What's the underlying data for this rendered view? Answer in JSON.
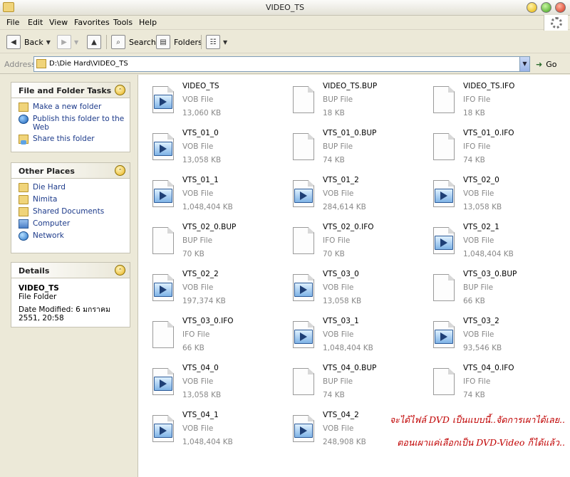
{
  "window": {
    "title": "VIDEO_TS"
  },
  "menu": [
    "File",
    "Edit",
    "View",
    "Favorites",
    "Tools",
    "Help"
  ],
  "toolbar": {
    "back_label": "Back",
    "search_label": "Search",
    "folders_label": "Folders"
  },
  "address": {
    "label": "Address",
    "path": "D:\\Die Hard\\VIDEO_TS",
    "go_label": "Go"
  },
  "tasks": {
    "title": "File and Folder Tasks",
    "items": [
      "Make a new folder",
      "Publish this folder to the Web",
      "Share this folder"
    ]
  },
  "places": {
    "title": "Other Places",
    "items": [
      "Die Hard",
      "Nimita",
      "Shared Documents",
      "Computer",
      "Network"
    ]
  },
  "details": {
    "title": "Details",
    "name": "VIDEO_TS",
    "kind": "File Folder",
    "modified": "Date Modified: 6 มกราคม 2551, 20:58"
  },
  "files": [
    {
      "name": "VIDEO_TS",
      "type": "VOB File",
      "size": "13,060 KB",
      "icon": "media"
    },
    {
      "name": "VIDEO_TS.BUP",
      "type": "BUP File",
      "size": "18 KB",
      "icon": "doc"
    },
    {
      "name": "VIDEO_TS.IFO",
      "type": "IFO File",
      "size": "18 KB",
      "icon": "doc"
    },
    {
      "name": "VTS_01_0",
      "type": "VOB File",
      "size": "13,058 KB",
      "icon": "media"
    },
    {
      "name": "VTS_01_0.BUP",
      "type": "BUP File",
      "size": "74 KB",
      "icon": "doc"
    },
    {
      "name": "VTS_01_0.IFO",
      "type": "IFO File",
      "size": "74 KB",
      "icon": "doc"
    },
    {
      "name": "VTS_01_1",
      "type": "VOB File",
      "size": "1,048,404 KB",
      "icon": "media"
    },
    {
      "name": "VTS_01_2",
      "type": "VOB File",
      "size": "284,614 KB",
      "icon": "media"
    },
    {
      "name": "VTS_02_0",
      "type": "VOB File",
      "size": "13,058 KB",
      "icon": "media"
    },
    {
      "name": "VTS_02_0.BUP",
      "type": "BUP File",
      "size": "70 KB",
      "icon": "doc"
    },
    {
      "name": "VTS_02_0.IFO",
      "type": "IFO File",
      "size": "70 KB",
      "icon": "doc"
    },
    {
      "name": "VTS_02_1",
      "type": "VOB File",
      "size": "1,048,404 KB",
      "icon": "media"
    },
    {
      "name": "VTS_02_2",
      "type": "VOB File",
      "size": "197,374 KB",
      "icon": "media"
    },
    {
      "name": "VTS_03_0",
      "type": "VOB File",
      "size": "13,058 KB",
      "icon": "media"
    },
    {
      "name": "VTS_03_0.BUP",
      "type": "BUP File",
      "size": "66 KB",
      "icon": "doc"
    },
    {
      "name": "VTS_03_0.IFO",
      "type": "IFO File",
      "size": "66 KB",
      "icon": "doc"
    },
    {
      "name": "VTS_03_1",
      "type": "VOB File",
      "size": "1,048,404 KB",
      "icon": "media"
    },
    {
      "name": "VTS_03_2",
      "type": "VOB File",
      "size": "93,546 KB",
      "icon": "media"
    },
    {
      "name": "VTS_04_0",
      "type": "VOB File",
      "size": "13,058 KB",
      "icon": "media"
    },
    {
      "name": "VTS_04_0.BUP",
      "type": "BUP File",
      "size": "74 KB",
      "icon": "doc"
    },
    {
      "name": "VTS_04_0.IFO",
      "type": "IFO File",
      "size": "74 KB",
      "icon": "doc"
    },
    {
      "name": "VTS_04_1",
      "type": "VOB File",
      "size": "1,048,404 KB",
      "icon": "media"
    },
    {
      "name": "VTS_04_2",
      "type": "VOB File",
      "size": "248,908 KB",
      "icon": "media"
    }
  ],
  "annotation": {
    "line1": "จะได้ไฟล์ DVD เป็นแบบนี้..จัดการเผาได้เลย..",
    "line2": "ตอนเผาแค่เลือกเป็น DVD-Video ก็ได้แล้ว.."
  }
}
